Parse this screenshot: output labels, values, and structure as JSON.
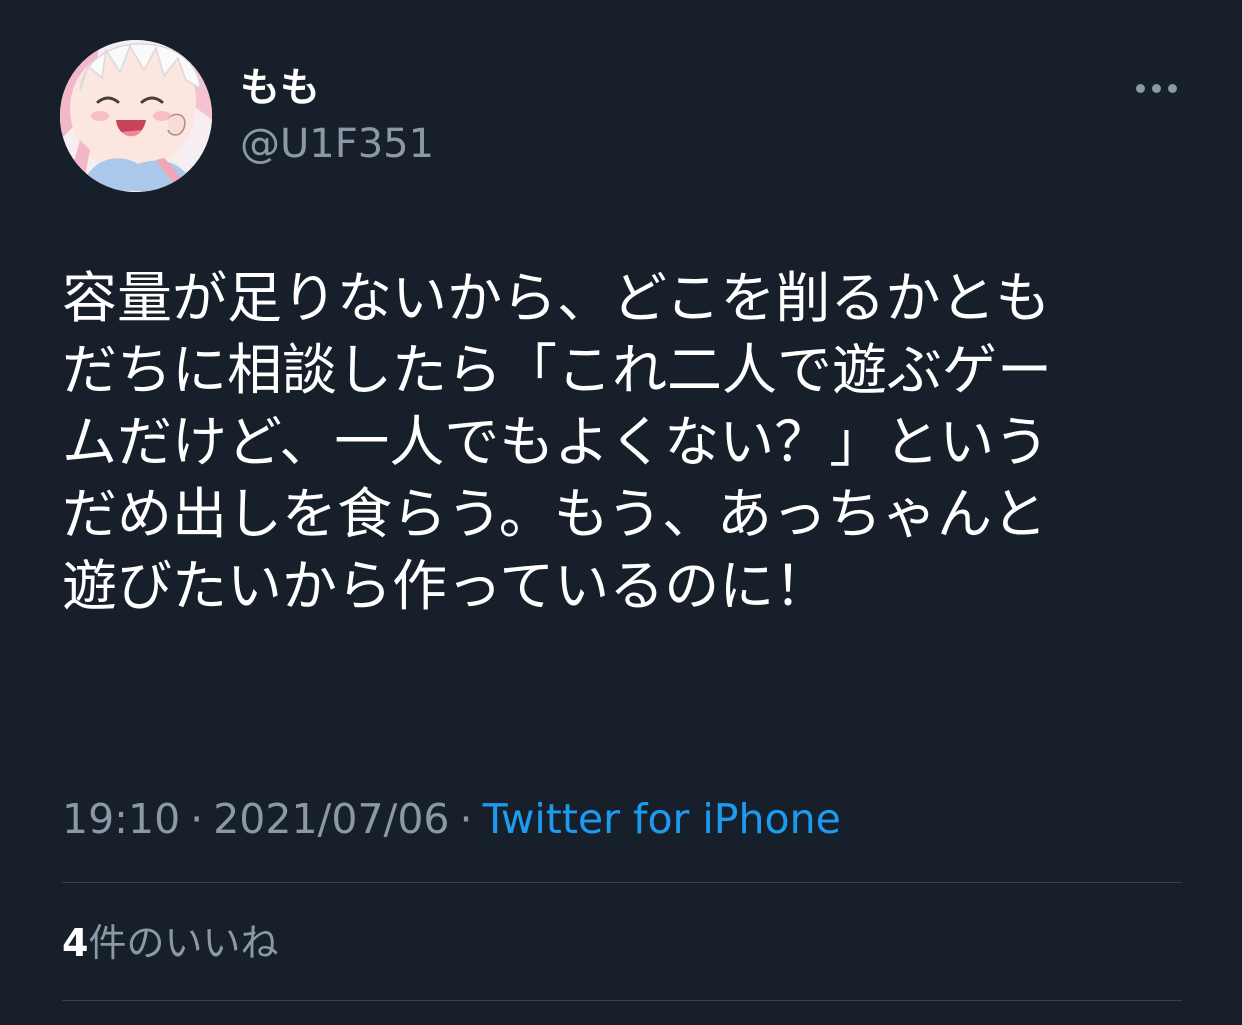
{
  "user": {
    "display_name": "もも",
    "handle": "@U1F351"
  },
  "more_icon": "more-horizontal-icon",
  "tweet": {
    "lines": [
      "容量が足りないから、どこを削るかとも",
      "だちに相談したら「これ二人で遊ぶゲー",
      "ムだけど、一人でもよくない？」という",
      "だめ出しを食らう。もう、あっちゃんと",
      "遊びたいから作っているのに！"
    ]
  },
  "meta": {
    "time": "19:10",
    "separator": "·",
    "date": "2021/07/06",
    "source": "Twitter for iPhone"
  },
  "likes": {
    "count": "4",
    "label": "件のいいね"
  },
  "colors": {
    "background": "#17202a",
    "text_primary": "#ffffff",
    "text_secondary": "#8b98a5",
    "accent": "#1d9bf0",
    "divider": "#38444d"
  }
}
